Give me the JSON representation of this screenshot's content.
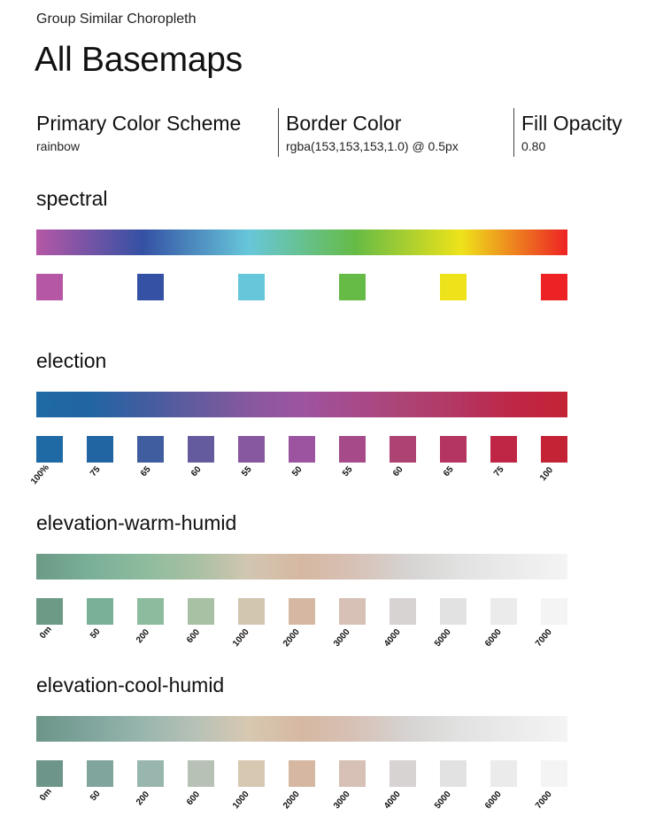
{
  "header": {
    "subtitle": "Group Similar Choropleth",
    "title": "All Basemaps"
  },
  "properties": [
    {
      "label": "Primary Color Scheme",
      "value": "rainbow"
    },
    {
      "label": "Border Color",
      "value": "rgba(153,153,153,1.0) @ 0.5px"
    },
    {
      "label": "Fill Opacity",
      "value": "0.80"
    }
  ],
  "schemes": [
    {
      "name": "spectral",
      "gradient": [
        "#b657a6",
        "#3451a4",
        "#67c7da",
        "#66bb46",
        "#eee31a",
        "#ed2224"
      ],
      "swatches": [
        "#b657a6",
        "#3451a4",
        "#67c7da",
        "#66bb46",
        "#eee31a",
        "#ed2224"
      ],
      "labels": []
    },
    {
      "name": "election",
      "gradient": [
        "#1f6aa4",
        "#2165a3",
        "#405da0",
        "#635b9e",
        "#87589f",
        "#9d54a0",
        "#a74a8a",
        "#ad4373",
        "#b43561",
        "#bf2645",
        "#c42335"
      ],
      "swatches": [
        "#1f6aa4",
        "#2165a3",
        "#405da0",
        "#635b9e",
        "#87589f",
        "#9d54a0",
        "#a74a8a",
        "#ad4373",
        "#b43561",
        "#bf2645",
        "#c42335"
      ],
      "labels": [
        "100%",
        "75",
        "65",
        "60",
        "55",
        "50",
        "55",
        "60",
        "65",
        "75",
        "100"
      ]
    },
    {
      "name": "elevation-warm-humid",
      "gradient": [
        "#6c9a86",
        "#7aaf98",
        "#8dbb9d",
        "#a8c0a3",
        "#d2c6b1",
        "#d6b8a2",
        "#d7c1b6",
        "#d6d3d2",
        "#e1e2e1",
        "#ebebeb",
        "#f4f4f4"
      ],
      "swatches": [
        "#6c9a86",
        "#7aaf98",
        "#8dbb9d",
        "#a8c0a3",
        "#d2c6b1",
        "#d6b8a2",
        "#d7c1b6",
        "#d6d3d2",
        "#e1e2e1",
        "#ebebeb",
        "#f4f4f4"
      ],
      "labels": [
        "0m",
        "50",
        "200",
        "600",
        "1000",
        "2000",
        "3000",
        "4000",
        "5000",
        "6000",
        "7000"
      ]
    },
    {
      "name": "elevation-cool-humid",
      "gradient": [
        "#6d9589",
        "#7fa59c",
        "#98b6ae",
        "#b7c1b6",
        "#d7c8b1",
        "#d6b8a2",
        "#d7c1b6",
        "#d6d3d2",
        "#e1e2e1",
        "#ebebeb",
        "#f4f4f4"
      ],
      "swatches": [
        "#6d9589",
        "#7fa59c",
        "#98b6ae",
        "#b7c1b6",
        "#d7c8b1",
        "#d6b8a2",
        "#d7c1b6",
        "#d6d3d2",
        "#e1e2e1",
        "#ebebeb",
        "#f4f4f4"
      ],
      "labels": [
        "0m",
        "50",
        "200",
        "600",
        "1000",
        "2000",
        "3000",
        "4000",
        "5000",
        "6000",
        "7000"
      ]
    }
  ]
}
